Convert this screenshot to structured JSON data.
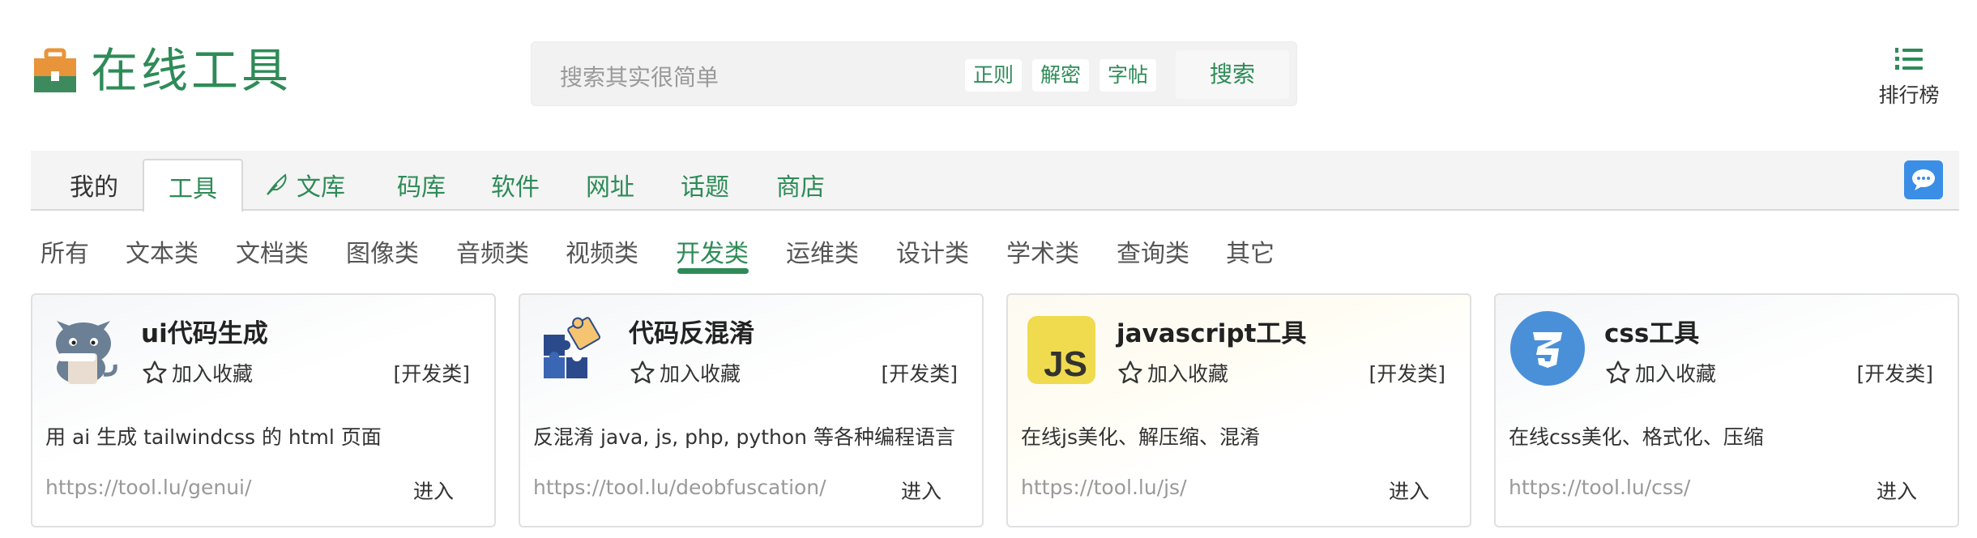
{
  "header": {
    "title": "在线工具",
    "search_placeholder": "搜索其实很简单",
    "chips": [
      "正则",
      "解密",
      "字帖"
    ],
    "search_button": "搜索",
    "rank_label": "排行榜"
  },
  "nav": {
    "items": [
      "我的",
      "工具",
      "文库",
      "码库",
      "软件",
      "网址",
      "话题",
      "商店"
    ],
    "active": "工具"
  },
  "categories": {
    "items": [
      "所有",
      "文本类",
      "文档类",
      "图像类",
      "音频类",
      "视频类",
      "开发类",
      "运维类",
      "设计类",
      "学术类",
      "查询类",
      "其它"
    ],
    "active": "开发类"
  },
  "cards": [
    {
      "title": "ui代码生成",
      "fav": "加入收藏",
      "category": "[开发类]",
      "desc": "用 ai 生成 tailwindcss 的 html 页面",
      "url": "https://tool.lu/genui/",
      "enter": "进入",
      "icon": "cat-mascot-icon"
    },
    {
      "title": "代码反混淆",
      "fav": "加入收藏",
      "category": "[开发类]",
      "desc": "反混淆 java, js, php, python 等各种编程语言",
      "url": "https://tool.lu/deobfuscation/",
      "enter": "进入",
      "icon": "puzzle-icon"
    },
    {
      "title": "javascript工具",
      "fav": "加入收藏",
      "category": "[开发类]",
      "desc": "在线js美化、解压缩、混淆",
      "url": "https://tool.lu/js/",
      "enter": "进入",
      "icon": "js-logo-icon",
      "icon_text": "JS"
    },
    {
      "title": "css工具",
      "fav": "加入收藏",
      "category": "[开发类]",
      "desc": "在线css美化、格式化、压缩",
      "url": "https://tool.lu/css/",
      "enter": "进入",
      "icon": "css3-logo-icon"
    }
  ],
  "colors": {
    "brand": "#2e8b57",
    "chat": "#3a8ee6",
    "js_yellow": "#f0db4f",
    "css_blue": "#4a90d9"
  }
}
